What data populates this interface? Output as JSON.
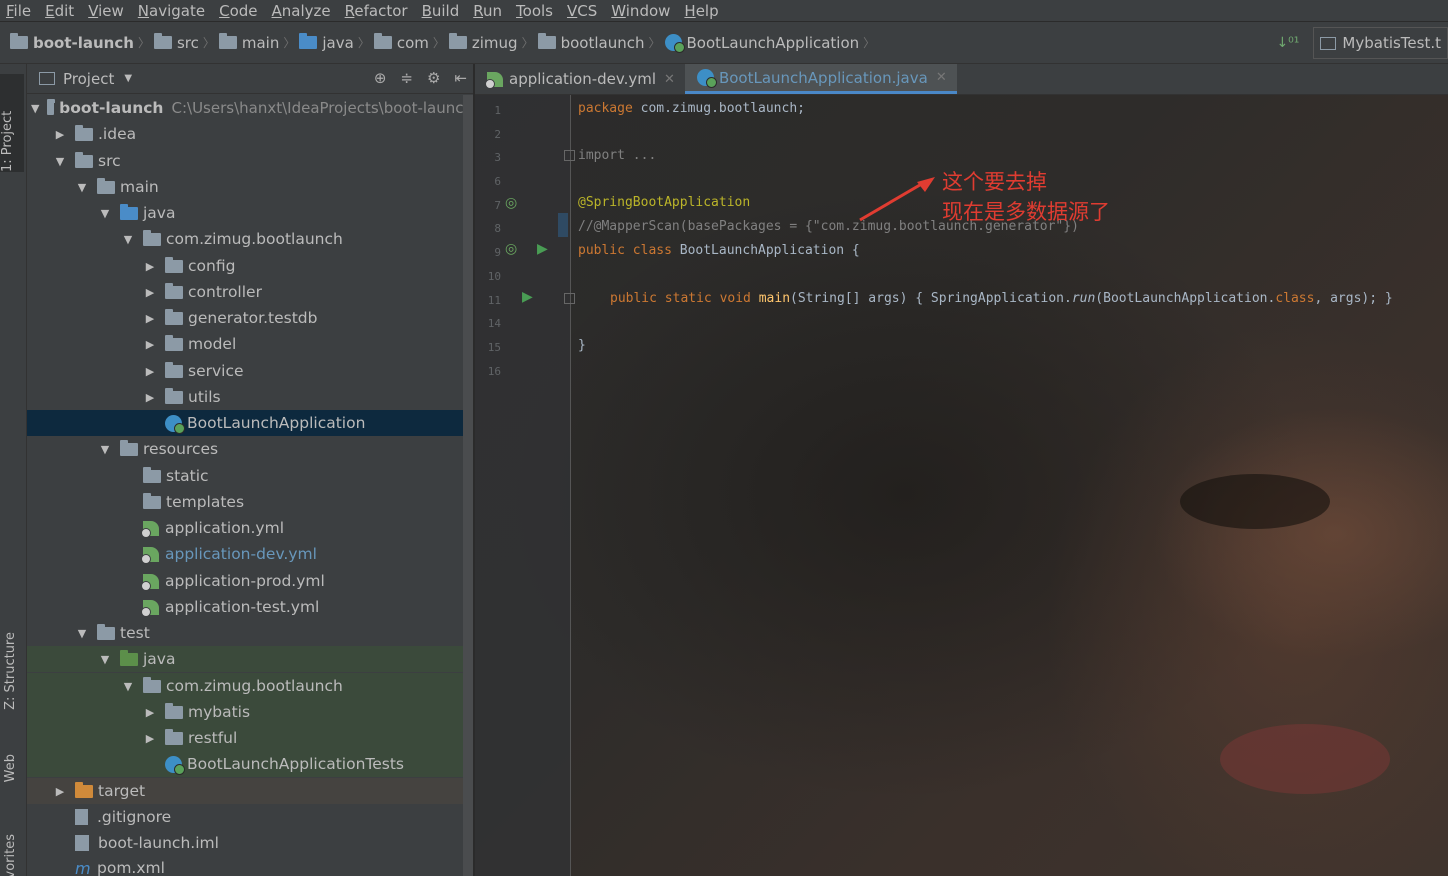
{
  "menu": [
    "File",
    "Edit",
    "View",
    "Navigate",
    "Code",
    "Analyze",
    "Refactor",
    "Build",
    "Run",
    "Tools",
    "VCS",
    "Window",
    "Help"
  ],
  "breadcrumbs": [
    "boot-launch",
    "src",
    "main",
    "java",
    "com",
    "zimug",
    "bootlaunch",
    "BootLaunchApplication"
  ],
  "run_config": "MybatisTest.t",
  "side_labels": {
    "project": "1: Project",
    "structure": "Z: Structure",
    "web": "Web",
    "favorites": "vorites"
  },
  "project_panel": {
    "title": "Project",
    "tree": [
      {
        "label": "boot-launch",
        "path": "C:\\Users\\hanxt\\IdeaProjects\\boot-launch",
        "arrow": "▼"
      },
      {
        "label": ".idea",
        "arrow": "▶"
      },
      {
        "label": "src",
        "arrow": "▼"
      },
      {
        "label": "main",
        "arrow": "▼"
      },
      {
        "label": "java",
        "arrow": "▼"
      },
      {
        "label": "com.zimug.bootlaunch",
        "arrow": "▼"
      },
      {
        "label": "config",
        "arrow": "▶"
      },
      {
        "label": "controller",
        "arrow": "▶"
      },
      {
        "label": "generator.testdb",
        "arrow": "▶"
      },
      {
        "label": "model",
        "arrow": "▶"
      },
      {
        "label": "service",
        "arrow": "▶"
      },
      {
        "label": "utils",
        "arrow": "▶"
      },
      {
        "label": "BootLaunchApplication",
        "arrow": ""
      },
      {
        "label": "resources",
        "arrow": "▼"
      },
      {
        "label": "static",
        "arrow": ""
      },
      {
        "label": "templates",
        "arrow": ""
      },
      {
        "label": "application.yml",
        "arrow": ""
      },
      {
        "label": "application-dev.yml",
        "arrow": ""
      },
      {
        "label": "application-prod.yml",
        "arrow": ""
      },
      {
        "label": "application-test.yml",
        "arrow": ""
      },
      {
        "label": "test",
        "arrow": "▼"
      },
      {
        "label": "java",
        "arrow": "▼"
      },
      {
        "label": "com.zimug.bootlaunch",
        "arrow": "▼"
      },
      {
        "label": "mybatis",
        "arrow": "▶"
      },
      {
        "label": "restful",
        "arrow": "▶"
      },
      {
        "label": "BootLaunchApplicationTests",
        "arrow": ""
      },
      {
        "label": "target",
        "arrow": "▶"
      },
      {
        "label": ".gitignore",
        "arrow": ""
      },
      {
        "label": "boot-launch.iml",
        "arrow": ""
      },
      {
        "label": "pom.xml",
        "arrow": ""
      }
    ]
  },
  "editor": {
    "tabs": [
      {
        "label": "application-dev.yml",
        "active": false
      },
      {
        "label": "BootLaunchApplication.java",
        "active": true
      }
    ],
    "line_numbers": [
      "1",
      "2",
      "3",
      "6",
      "7",
      "8",
      "9",
      "10",
      "11",
      "14",
      "15",
      "16"
    ],
    "code": {
      "l1_kw": "package",
      "l1_rest": " com.zimug.bootlaunch;",
      "l3": "import ...",
      "l7": "@SpringBootApplication",
      "l8": "//@MapperScan(basePackages = {\"com.zimug.bootlaunch.generator\"})",
      "l9_kw": "public class",
      "l9_rest": " BootLaunchApplication {",
      "l11_kw": "public static void",
      "l11_main": " main",
      "l11_args": "(String[] args) ",
      "l11_body1": "{ SpringApplication.",
      "l11_run": "run",
      "l11_body2": "(BootLaunchApplication.",
      "l11_cls": "class",
      "l11_body3": ", args); }",
      "l15": "}"
    },
    "callout": "这个要去掉\n现在是多数据源了"
  },
  "colors": {
    "accent": "#4a88c7",
    "selection": "#0d293e",
    "callout": "#e03c31"
  }
}
